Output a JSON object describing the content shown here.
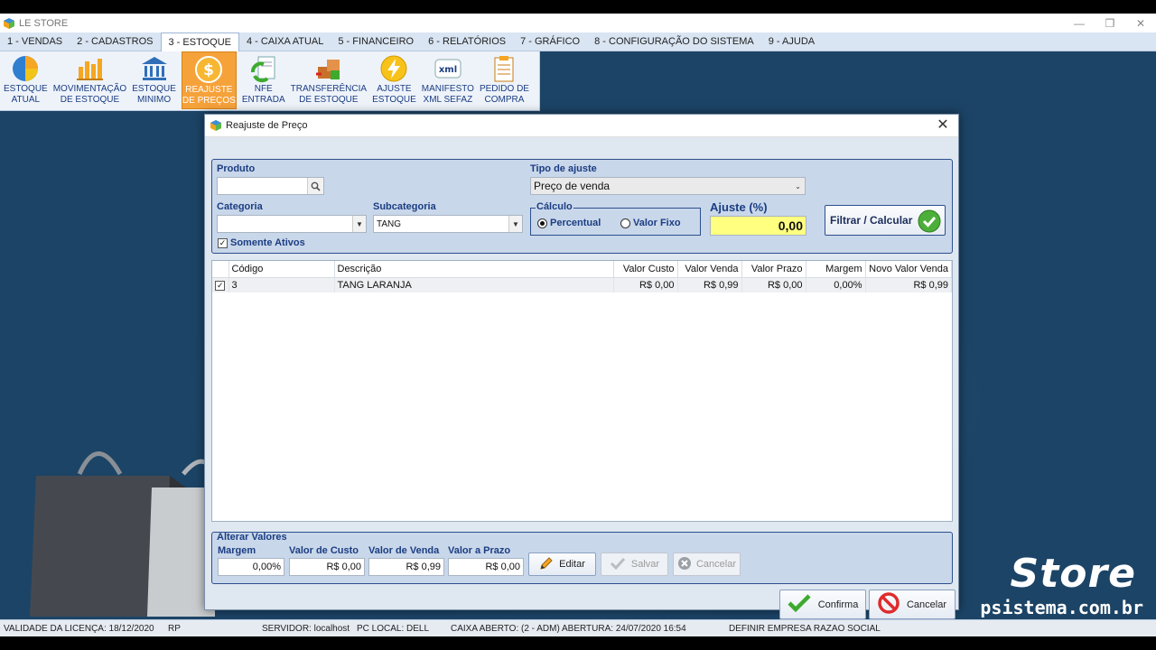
{
  "window": {
    "title": "LE STORE",
    "minimize": "—",
    "restore": "❐",
    "close": "✕"
  },
  "menu": [
    {
      "label": "1 - VENDAS",
      "active": false
    },
    {
      "label": "2 - CADASTROS",
      "active": false
    },
    {
      "label": "3 - ESTOQUE",
      "active": true
    },
    {
      "label": "4 - CAIXA ATUAL",
      "active": false
    },
    {
      "label": "5 - FINANCEIRO",
      "active": false
    },
    {
      "label": "6 - RELATÓRIOS",
      "active": false
    },
    {
      "label": "7 - GRÁFICO",
      "active": false
    },
    {
      "label": "8 - CONFIGURAÇÃO DO SISTEMA",
      "active": false
    },
    {
      "label": "9 - AJUDA",
      "active": false
    }
  ],
  "ribbon": [
    {
      "label": "ESTOQUE\nATUAL",
      "icon": "pie-chart-icon"
    },
    {
      "label": "MOVIMENTAÇÃO\nDE ESTOQUE",
      "icon": "bar-chart-icon"
    },
    {
      "label": "ESTOQUE\nMINIMO",
      "icon": "bank-icon"
    },
    {
      "label": "REAJUSTE\nDE PREÇOS",
      "icon": "dollar-coin-icon",
      "active": true
    },
    {
      "label": "NFE\nENTRADA",
      "icon": "document-sync-icon"
    },
    {
      "label": "TRANSFERÊNCIA\nDE ESTOQUE",
      "icon": "boxes-icon"
    },
    {
      "label": "AJUSTE\nESTOQUE",
      "icon": "lightning-icon"
    },
    {
      "label": "MANIFESTO\nXML SEFAZ",
      "icon": "xml-icon"
    },
    {
      "label": "PEDIDO DE\nCOMPRA",
      "icon": "clipboard-icon"
    }
  ],
  "dialog": {
    "title": "Reajuste de Preço",
    "produto_label": "Produto",
    "produto_value": "",
    "tipo_label": "Tipo de ajuste",
    "tipo_value": "Preço de venda",
    "categoria_label": "Categoria",
    "categoria_value": "",
    "subcategoria_label": "Subcategoria",
    "subcategoria_value": "TANG",
    "somente_ativos_label": "Somente Ativos",
    "calculo_label": "Cálculo",
    "radio_percentual": "Percentual",
    "radio_fixo": "Valor Fixo",
    "ajuste_label": "Ajuste (%)",
    "ajuste_value": "0,00",
    "filtrar_label": "Filtrar / Calcular",
    "grid": {
      "columns": [
        "Código",
        "Descrição",
        "Valor Custo",
        "Valor Venda",
        "Valor Prazo",
        "Margem",
        "Novo Valor Venda"
      ],
      "rows": [
        {
          "codigo": "3",
          "descricao": "TANG LARANJA",
          "custo": "R$ 0,00",
          "venda": "R$ 0,99",
          "prazo": "R$ 0,00",
          "margem": "0,00%",
          "novo": "R$ 0,99"
        }
      ]
    },
    "alterar": {
      "title": "Alterar Valores",
      "margem_label": "Margem",
      "margem_value": "0,00%",
      "custo_label": "Valor de Custo",
      "custo_value": "R$ 0,00",
      "venda_label": "Valor de Venda",
      "venda_value": "R$ 0,99",
      "prazo_label": "Valor a Prazo",
      "prazo_value": "R$ 0,00",
      "editar": "Editar",
      "salvar": "Salvar",
      "cancelar": "Cancelar"
    },
    "confirma": "Confirma",
    "cancelar": "Cancelar"
  },
  "brand": {
    "name": "Store",
    "url": "psistema.com.br"
  },
  "status": {
    "licenca": "VALIDADE DA LICENÇA: 18/12/2020",
    "uf": "RP",
    "servidor": "SERVIDOR: localhost",
    "pc": "PC LOCAL: DELL",
    "caixa": "CAIXA ABERTO: (2 - ADM) ABERTURA: 24/07/2020 16:54",
    "empresa": "DEFINIR EMPRESA RAZAO SOCIAL"
  },
  "colors": {
    "accent": "#f6a23b",
    "label_blue": "#1b3d82",
    "ajuste_bg": "#ffff80"
  }
}
